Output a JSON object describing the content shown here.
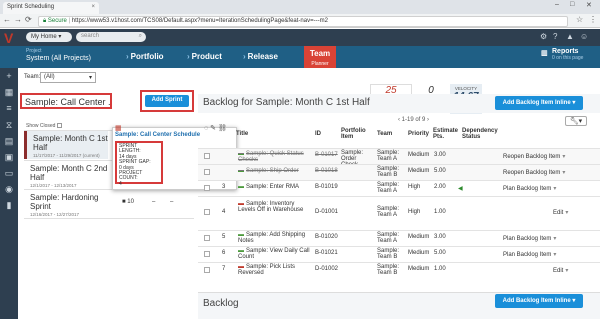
{
  "browser": {
    "tab_title": "Sprint Scheduling",
    "secure_label": "Secure",
    "url": "https://www53.v1host.com/TCS08/Default.aspx?menu=IterationSchedulingPage&feat-nav=---m2"
  },
  "appbar": {
    "home_label": "My Home",
    "search_placeholder": "search"
  },
  "project": {
    "label": "Project",
    "name": "System (All Projects)"
  },
  "main_nav": {
    "portfolio": "Portfolio",
    "product": "Product",
    "release": "Release",
    "team": "Team",
    "team_sub": "Planner",
    "reports": "Reports",
    "reports_sub": "0 on this page"
  },
  "team_filter": {
    "label": "Team:",
    "value": "(All)"
  },
  "sprint_panel": {
    "title": "Sample: Call Center ...",
    "add_sprint": "Add Sprint",
    "show_closed": "Show Closed",
    "sprints": [
      {
        "name": "Sample: Month C 1st Half",
        "dates": "11/17/2017 - 11/29/2017 (current)"
      },
      {
        "name": "Sample: Month C 2nd Half",
        "dates": "12/1/2017 - 12/13/2017"
      },
      {
        "name": "Sample: Hardoning Sprint",
        "dates": "12/16/2017 - 12/27/2017"
      }
    ],
    "row_extra": {
      "count": "10",
      "dash1": "–",
      "dash2": "–"
    }
  },
  "popup": {
    "title": "Sample: Call Center Schedule",
    "length_label": "SPRINT LENGTH:",
    "length_value": "14 days",
    "gap_label": "SPRINT GAP:",
    "gap_value": "0 days",
    "count_label": "PROJECT COUNT:",
    "count_value": "4"
  },
  "counters": {
    "planned_value": "25",
    "planned_label": "PLANNED",
    "target_value": "0",
    "target_label": "TARGET",
    "velocity_label": "VELOCITY",
    "velocity_value": "14.67"
  },
  "backlog_header": {
    "title": "Backlog for Sample: Month C 1st Half",
    "add_button": "Add Backlog Item Inline",
    "pager": "1-19 of 9"
  },
  "table": {
    "headers": {
      "title": "Title",
      "id": "ID",
      "portfolio": "Portfolio Item",
      "team": "Team",
      "priority": "Priority",
      "estimate": "Estimate Pts.",
      "dependency": "Dependency Status"
    },
    "rows": [
      {
        "num": "",
        "title": "Sample: Quick Status Checks",
        "id": "B-01017",
        "portfolio": "Sample: Order Check",
        "team": "Sample: Team A",
        "priority": "Medium",
        "est": "3.00",
        "action": "Reopen Backlog Item"
      },
      {
        "num": "",
        "title": "Sample: Ship Order",
        "id": "B-01018",
        "portfolio": "",
        "team": "Sample: Team B",
        "priority": "Medium",
        "est": "5.00",
        "action": "Reopen Backlog Item"
      },
      {
        "num": "3",
        "title": "Sample: Enter RMA",
        "id": "B-01019",
        "portfolio": "",
        "team": "Sample: Team A",
        "priority": "High",
        "est": "2.00",
        "action": "Plan Backlog Item"
      },
      {
        "num": "4",
        "title": "Sample: Inventory Levels Off in Warehouse",
        "id": "D-01001",
        "portfolio": "",
        "team": "Sample: Team A",
        "priority": "High",
        "est": "1.00",
        "action": "Edit"
      },
      {
        "num": "5",
        "title": "Sample: Add Shipping Notes",
        "id": "B-01020",
        "portfolio": "",
        "team": "Sample: Team A",
        "priority": "Medium",
        "est": "3.00",
        "action": "Plan Backlog Item"
      },
      {
        "num": "6",
        "title": "Sample: View Daily Call Count",
        "id": "B-01021",
        "portfolio": "",
        "team": "Sample: Team B",
        "priority": "Medium",
        "est": "5.00",
        "action": "Plan Backlog Item"
      },
      {
        "num": "7",
        "title": "Sample: Pick Lists Reversed",
        "id": "D-01002",
        "portfolio": "",
        "team": "Sample: Team B",
        "priority": "Medium",
        "est": "1.00",
        "action": "Edit"
      }
    ]
  },
  "bottom_backlog": {
    "title": "Backlog",
    "add_button": "Add Backlog Item Inline"
  }
}
